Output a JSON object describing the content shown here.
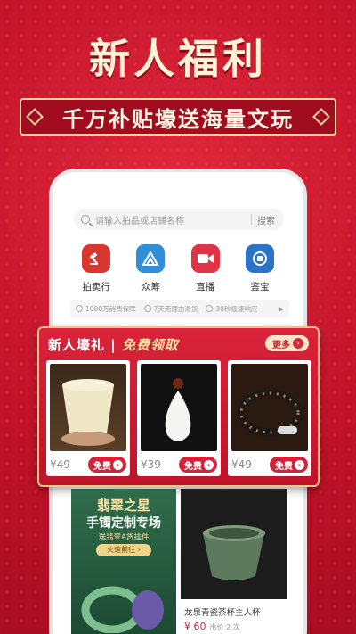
{
  "promo": {
    "headline": "新人福利",
    "subline": "千万补贴壕送海量文玩"
  },
  "search": {
    "placeholder": "请输入拍品或店铺名称",
    "button": "搜索"
  },
  "categories": [
    {
      "label": "拍卖行",
      "icon": "gavel-icon",
      "color": "#d9362f"
    },
    {
      "label": "众筹",
      "icon": "mountain-icon",
      "color": "#2f8ed8"
    },
    {
      "label": "直播",
      "icon": "video-camera-icon",
      "color": "#e03446"
    },
    {
      "label": "鉴宝",
      "icon": "magnifier-icon",
      "color": "#2a73c7"
    }
  ],
  "guarantees": [
    {
      "text": "1000万消费保障"
    },
    {
      "text": "7天无理由退货"
    },
    {
      "text": "30秒极速响应"
    }
  ],
  "gift_panel": {
    "title": "新人壕礼",
    "divider": "|",
    "subtitle": "免费领取",
    "more": "更多",
    "items": [
      {
        "price": "¥49",
        "action": "免费"
      },
      {
        "price": "¥39",
        "action": "免费"
      },
      {
        "price": "¥49",
        "action": "免费"
      }
    ]
  },
  "feed": {
    "left": {
      "title1": "翡翠之星",
      "title2": "手镯定制专场",
      "title3": "送翡翠A货挂件",
      "button": "火速前往 ›"
    },
    "right": {
      "name": "龙泉青瓷茶杯主人杯",
      "price": "¥ 60",
      "sold": "出价 2 次"
    }
  }
}
